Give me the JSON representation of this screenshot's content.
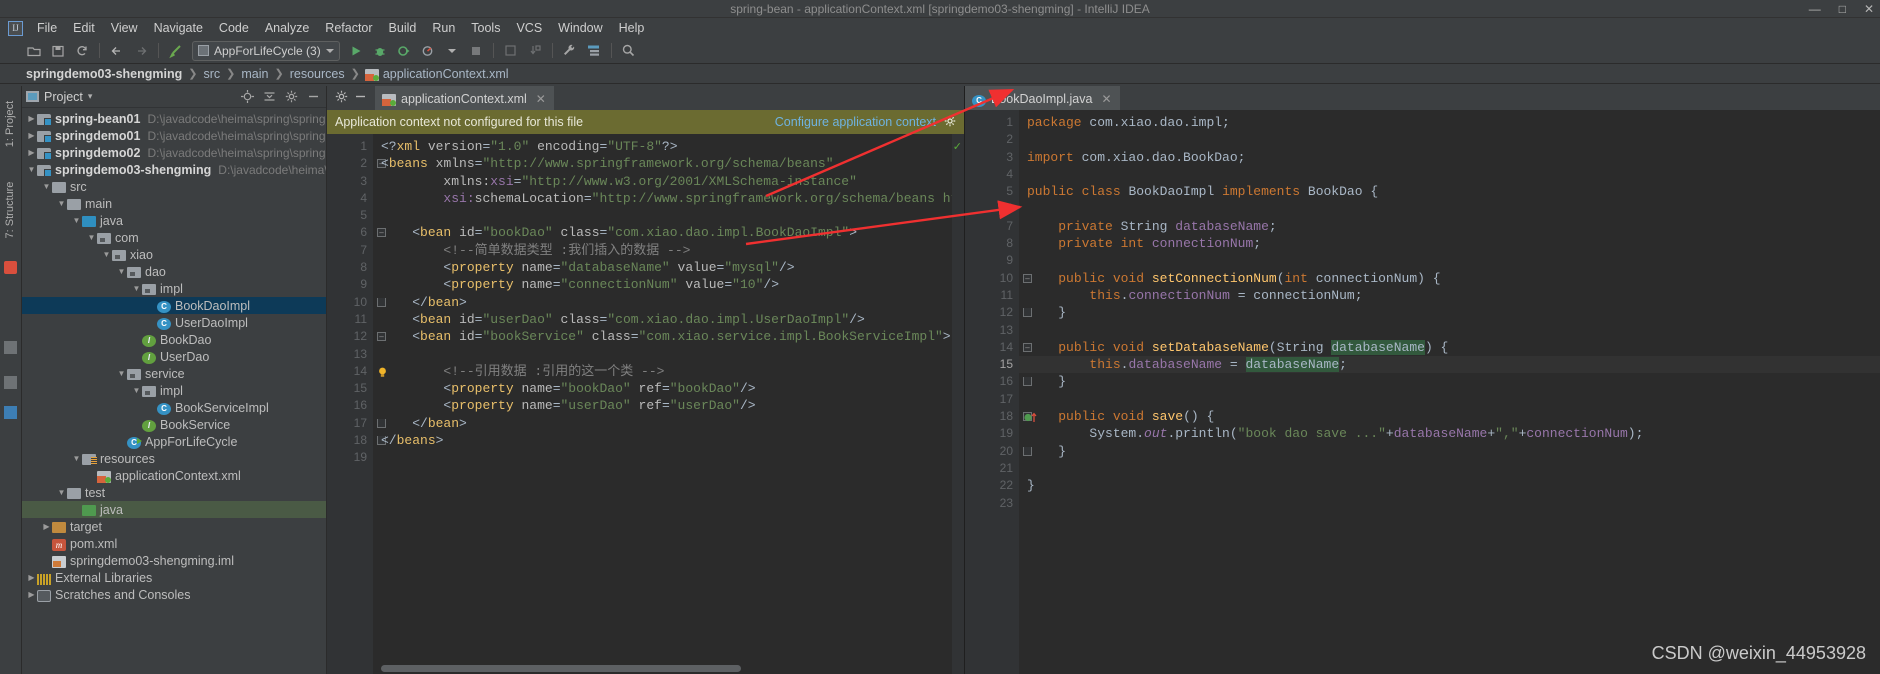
{
  "window": {
    "title": "spring-bean - applicationContext.xml [springdemo03-shengming] - IntelliJ IDEA",
    "minimize": "—",
    "maximize": "□",
    "close": "✕",
    "logo": "IJ"
  },
  "menu": [
    "File",
    "Edit",
    "View",
    "Navigate",
    "Code",
    "Analyze",
    "Refactor",
    "Build",
    "Run",
    "Tools",
    "VCS",
    "Window",
    "Help"
  ],
  "toolbar": {
    "run_config": "AppForLifeCycle (3)",
    "icons": [
      "open-folder-icon",
      "save-icon",
      "sync-icon",
      "back-arrow-icon",
      "forward-arrow-icon",
      "build-icon",
      "run-icon",
      "debug-icon",
      "coverage-icon",
      "profiler-icon",
      "stop-icon",
      "update-project-icon",
      "commit-icon",
      "settings-wrench-icon",
      "structure-icon",
      "search-icon"
    ]
  },
  "breadcrumb": {
    "items": [
      "springdemo03-shengming",
      "src",
      "main",
      "resources",
      "applicationContext.xml"
    ]
  },
  "sidebar": {
    "vertical_tabs": [
      "1: Project",
      "7: Structure"
    ],
    "header": {
      "title": "Project",
      "chevron": "▾",
      "locate_icon": "locate-icon",
      "collapse_icon": "collapse-all-icon",
      "settings_icon": "gear-icon",
      "hide_icon": "hide-icon"
    },
    "tree": [
      {
        "depth": 0,
        "arrow": "▶",
        "icon": "module-folder",
        "name": "spring-bean01",
        "bold": true,
        "path": "D:\\javadcode\\heima\\spring\\spring-bea"
      },
      {
        "depth": 0,
        "arrow": "▶",
        "icon": "module-folder",
        "name": "springdemo01",
        "bold": true,
        "path": "D:\\javadcode\\heima\\spring\\springdem"
      },
      {
        "depth": 0,
        "arrow": "▶",
        "icon": "module-folder",
        "name": "springdemo02",
        "bold": true,
        "path": "D:\\javadcode\\heima\\spring\\springdem"
      },
      {
        "depth": 0,
        "arrow": "▼",
        "icon": "module-folder",
        "name": "springdemo03-shengming",
        "bold": true,
        "path": "D:\\javadcode\\heima\\sprin"
      },
      {
        "depth": 1,
        "arrow": "▼",
        "icon": "folder",
        "name": "src",
        "bold": false,
        "path": ""
      },
      {
        "depth": 2,
        "arrow": "▼",
        "icon": "folder",
        "name": "main",
        "bold": false,
        "path": ""
      },
      {
        "depth": 3,
        "arrow": "▼",
        "icon": "folder-blue",
        "name": "java",
        "bold": false,
        "path": ""
      },
      {
        "depth": 4,
        "arrow": "▼",
        "icon": "package",
        "name": "com",
        "bold": false,
        "path": ""
      },
      {
        "depth": 5,
        "arrow": "▼",
        "icon": "package",
        "name": "xiao",
        "bold": false,
        "path": ""
      },
      {
        "depth": 6,
        "arrow": "▼",
        "icon": "package",
        "name": "dao",
        "bold": false,
        "path": ""
      },
      {
        "depth": 7,
        "arrow": "▼",
        "icon": "package",
        "name": "impl",
        "bold": false,
        "path": ""
      },
      {
        "depth": 8,
        "arrow": "",
        "icon": "class",
        "name": "BookDaoImpl",
        "bold": false,
        "path": "",
        "selected": true
      },
      {
        "depth": 8,
        "arrow": "",
        "icon": "class",
        "name": "UserDaoImpl",
        "bold": false,
        "path": ""
      },
      {
        "depth": 7,
        "arrow": "",
        "icon": "interface",
        "name": "BookDao",
        "bold": false,
        "path": ""
      },
      {
        "depth": 7,
        "arrow": "",
        "icon": "interface",
        "name": "UserDao",
        "bold": false,
        "path": ""
      },
      {
        "depth": 6,
        "arrow": "▼",
        "icon": "package",
        "name": "service",
        "bold": false,
        "path": ""
      },
      {
        "depth": 7,
        "arrow": "▼",
        "icon": "package",
        "name": "impl",
        "bold": false,
        "path": ""
      },
      {
        "depth": 8,
        "arrow": "",
        "icon": "class",
        "name": "BookServiceImpl",
        "bold": false,
        "path": ""
      },
      {
        "depth": 7,
        "arrow": "",
        "icon": "interface",
        "name": "BookService",
        "bold": false,
        "path": ""
      },
      {
        "depth": 6,
        "arrow": "",
        "icon": "class-runnable",
        "name": "AppForLifeCycle",
        "bold": false,
        "path": ""
      },
      {
        "depth": 3,
        "arrow": "▼",
        "icon": "folder-resources",
        "name": "resources",
        "bold": false,
        "path": ""
      },
      {
        "depth": 4,
        "arrow": "",
        "icon": "xml",
        "name": "applicationContext.xml",
        "bold": false,
        "path": ""
      },
      {
        "depth": 2,
        "arrow": "▼",
        "icon": "folder",
        "name": "test",
        "bold": false,
        "path": ""
      },
      {
        "depth": 3,
        "arrow": "",
        "icon": "folder-green",
        "name": "java",
        "bold": false,
        "path": "",
        "green": true
      },
      {
        "depth": 1,
        "arrow": "▶",
        "icon": "folder-target",
        "name": "target",
        "bold": false,
        "path": ""
      },
      {
        "depth": 1,
        "arrow": "",
        "icon": "maven",
        "name": "pom.xml",
        "bold": false,
        "path": ""
      },
      {
        "depth": 1,
        "arrow": "",
        "icon": "iml",
        "name": "springdemo03-shengming.iml",
        "bold": false,
        "path": ""
      },
      {
        "depth": 0,
        "arrow": "▶",
        "icon": "library",
        "name": "External Libraries",
        "bold": false,
        "path": ""
      },
      {
        "depth": 0,
        "arrow": "▶",
        "icon": "scratch",
        "name": "Scratches and Consoles",
        "bold": false,
        "path": ""
      }
    ]
  },
  "editor_left": {
    "tab": {
      "label": "applicationContext.xml",
      "icon": "xml-file-icon",
      "close": "✕"
    },
    "notification": {
      "message": "Application context not configured for this file",
      "action": "Configure application context",
      "gear": "gear-icon"
    },
    "line_count": 19,
    "lines": [
      {
        "n": 1,
        "html": "<span class=\"s-punc\">&lt;?</span><span class=\"s-tag\">xml</span> <span class=\"s-attr\">version</span><span class=\"s-punc\">=</span><span class=\"s-val\">\"1.0\"</span> <span class=\"s-attr\">encoding</span><span class=\"s-punc\">=</span><span class=\"s-val\">\"UTF-8\"</span><span class=\"s-punc\">?&gt;</span>"
      },
      {
        "n": 2,
        "fold": "-",
        "html": "<span class=\"s-punc\">&lt;</span><span class=\"s-tag\">beans</span> <span class=\"s-attr\">xmlns</span><span class=\"s-punc\">=</span><span class=\"s-val\">\"http://www.springframework.org/schema/beans\"</span>"
      },
      {
        "n": 3,
        "html": "        <span class=\"s-attr\">xmlns:</span><span class=\"s-fld\">xsi</span><span class=\"s-punc\">=</span><span class=\"s-val\">\"http://www.w3.org/2001/XMLSchema-instance\"</span>"
      },
      {
        "n": 4,
        "html": "        <span class=\"s-fld\">xsi:</span><span class=\"s-attr\">schemaLocation</span><span class=\"s-punc\">=</span><span class=\"s-val\">\"http://www.springframework.org/schema/beans http://www.sprin</span>"
      },
      {
        "n": 5,
        "html": ""
      },
      {
        "n": 6,
        "fold": "-",
        "html": "    <span class=\"s-punc\">&lt;</span><span class=\"s-tag\">bean</span> <span class=\"s-attr\">id</span><span class=\"s-punc\">=</span><span class=\"s-val\">\"bookDao\"</span> <span class=\"s-attr\">class</span><span class=\"s-punc\">=</span><span class=\"s-val\">\"com.xiao.dao.impl.BookDaoImpl\"</span><span class=\"s-punc\">&gt;</span>"
      },
      {
        "n": 7,
        "html": "        <span class=\"s-cmt\">&lt;!--简单数据类型 :我们插入的数据 --&gt;</span>"
      },
      {
        "n": 8,
        "html": "        <span class=\"s-punc\">&lt;</span><span class=\"s-tag\">property</span> <span class=\"s-attr\">name</span><span class=\"s-punc\">=</span><span class=\"s-val\">\"databaseName\"</span> <span class=\"s-attr\">value</span><span class=\"s-punc\">=</span><span class=\"s-val\">\"mysql\"</span><span class=\"s-punc\">/&gt;</span>"
      },
      {
        "n": 9,
        "html": "        <span class=\"s-punc\">&lt;</span><span class=\"s-tag\">property</span> <span class=\"s-attr\">name</span><span class=\"s-punc\">=</span><span class=\"s-val\">\"connectionNum\"</span> <span class=\"s-attr\">value</span><span class=\"s-punc\">=</span><span class=\"s-val\">\"10\"</span><span class=\"s-punc\">/&gt;</span>"
      },
      {
        "n": 10,
        "fold": "u",
        "html": "    <span class=\"s-punc\">&lt;/</span><span class=\"s-tag\">bean</span><span class=\"s-punc\">&gt;</span>"
      },
      {
        "n": 11,
        "html": "    <span class=\"s-punc\">&lt;</span><span class=\"s-tag\">bean</span> <span class=\"s-attr\">id</span><span class=\"s-punc\">=</span><span class=\"s-val\">\"userDao\"</span> <span class=\"s-attr\">class</span><span class=\"s-punc\">=</span><span class=\"s-val\">\"com.xiao.dao.impl.UserDaoImpl\"</span><span class=\"s-punc\">/&gt;</span>"
      },
      {
        "n": 12,
        "fold": "-",
        "html": "    <span class=\"s-punc\">&lt;</span><span class=\"s-tag\">bean</span> <span class=\"s-attr\">id</span><span class=\"s-punc\">=</span><span class=\"s-val\">\"bookService\"</span> <span class=\"s-attr\">class</span><span class=\"s-punc\">=</span><span class=\"s-val\">\"com.xiao.service.impl.BookServiceImpl\"</span><span class=\"s-punc\">&gt;</span>"
      },
      {
        "n": 13,
        "html": ""
      },
      {
        "n": 14,
        "bulb": true,
        "html": "        <span class=\"s-cmt\">&lt;!--引用数据 :引用的这一个类 --&gt;</span>"
      },
      {
        "n": 15,
        "html": "        <span class=\"s-punc\">&lt;</span><span class=\"s-tag\">property</span> <span class=\"s-attr\">name</span><span class=\"s-punc\">=</span><span class=\"s-val\">\"bookDao\"</span> <span class=\"s-attr\">ref</span><span class=\"s-punc\">=</span><span class=\"s-val\">\"bookDao\"</span><span class=\"s-punc\">/&gt;</span>"
      },
      {
        "n": 16,
        "html": "        <span class=\"s-punc\">&lt;</span><span class=\"s-tag\">property</span> <span class=\"s-attr\">name</span><span class=\"s-punc\">=</span><span class=\"s-val\">\"userDao\"</span> <span class=\"s-attr\">ref</span><span class=\"s-punc\">=</span><span class=\"s-val\">\"userDao\"</span><span class=\"s-punc\">/&gt;</span>"
      },
      {
        "n": 17,
        "fold": "u",
        "html": "    <span class=\"s-punc\">&lt;/</span><span class=\"s-tag\">bean</span><span class=\"s-punc\">&gt;</span>"
      },
      {
        "n": 18,
        "fold": "u",
        "html": "<span class=\"s-punc\">&lt;/</span><span class=\"s-tag\">beans</span><span class=\"s-punc\">&gt;</span>"
      },
      {
        "n": 19,
        "html": ""
      }
    ]
  },
  "editor_right": {
    "tab": {
      "label": "BookDaoImpl.java",
      "icon": "java-class-icon",
      "close": "✕"
    },
    "lines": [
      {
        "n": 1,
        "html": "<span class=\"s-kw\">package</span> <span class=\"s-txt\">com.xiao.dao.impl</span><span class=\"s-txt\">;</span>"
      },
      {
        "n": 2,
        "html": ""
      },
      {
        "n": 3,
        "html": "<span class=\"s-kw\">import</span> <span class=\"s-txt\">com.xiao.dao.BookDao</span><span class=\"s-txt\">;</span>"
      },
      {
        "n": 4,
        "html": ""
      },
      {
        "n": 5,
        "html": "<span class=\"s-kw\">public class</span> <span class=\"s-txt\">BookDaoImpl</span> <span class=\"s-kw\">implements</span> <span class=\"s-txt\">BookDao {</span>"
      },
      {
        "n": 6,
        "html": ""
      },
      {
        "n": 7,
        "html": "    <span class=\"s-kw\">private</span> <span class=\"s-txt\">String</span> <span class=\"s-fld\">databaseName</span><span class=\"s-txt\">;</span>"
      },
      {
        "n": 8,
        "html": "    <span class=\"s-kw\">private int</span> <span class=\"s-fld\">connectionNum</span><span class=\"s-txt\">;</span>"
      },
      {
        "n": 9,
        "html": ""
      },
      {
        "n": 10,
        "fold": "-",
        "html": "    <span class=\"s-kw\">public void</span> <span class=\"s-def\">setConnectionNum</span><span class=\"s-txt\">(</span><span class=\"s-kw\">int</span> <span class=\"s-txt\">connectionNum) {</span>"
      },
      {
        "n": 11,
        "html": "        <span class=\"s-kw\">this</span><span class=\"s-txt\">.</span><span class=\"s-fld\">connectionNum</span> <span class=\"s-txt\">= connectionNum;</span>"
      },
      {
        "n": 12,
        "fold": "u",
        "html": "    <span class=\"s-txt\">}</span>"
      },
      {
        "n": 13,
        "html": ""
      },
      {
        "n": 14,
        "fold": "-",
        "html": "    <span class=\"s-kw\">public void</span> <span class=\"s-def\">setDatabaseName</span><span class=\"s-txt\">(</span><span class=\"s-txt\">String </span><span class=\"hlsearch s-txt\">databaseName</span><span class=\"s-txt\">) {</span>"
      },
      {
        "n": 15,
        "cur": true,
        "html": "        <span class=\"s-kw\">this</span><span class=\"s-txt\">.</span><span class=\"s-fld\">databaseName</span> <span class=\"s-txt\">= </span><span class=\"hlsearch s-txt\">databaseName</span><span class=\"s-txt\">;</span>"
      },
      {
        "n": 16,
        "fold": "u",
        "html": "    <span class=\"s-txt\">}</span>"
      },
      {
        "n": 17,
        "html": ""
      },
      {
        "n": 18,
        "fold": "-",
        "ovr": true,
        "html": "    <span class=\"s-kw\">public void</span> <span class=\"s-def\">save</span><span class=\"s-txt\">() {</span>"
      },
      {
        "n": 19,
        "html": "        <span class=\"s-txt\">System.</span><span class=\"s-stat\"><i>out</i></span><span class=\"s-txt\">.</span><span class=\"s-txt\">println(</span><span class=\"s-str\">\"book dao save ...\"</span><span class=\"s-txt\">+</span><span class=\"s-fld\">databaseName</span><span class=\"s-txt\">+</span><span class=\"s-str\">\",\"</span><span class=\"s-txt\">+</span><span class=\"s-fld\">connectionNum</span><span class=\"s-txt\">);</span>"
      },
      {
        "n": 20,
        "fold": "u",
        "html": "    <span class=\"s-txt\">}</span>"
      },
      {
        "n": 21,
        "html": ""
      },
      {
        "n": 22,
        "html": "<span class=\"s-txt\">}</span>"
      },
      {
        "n": 23,
        "html": ""
      }
    ]
  },
  "watermark": "CSDN @weixin_44953928",
  "colors": {
    "accent": "#3592c4",
    "notification_bg": "#6b6b31",
    "selection": "#0d3a58",
    "arrow_red": "#f03030",
    "editor_bg": "#2b2b2b",
    "chrome_bg": "#3c3f41"
  }
}
